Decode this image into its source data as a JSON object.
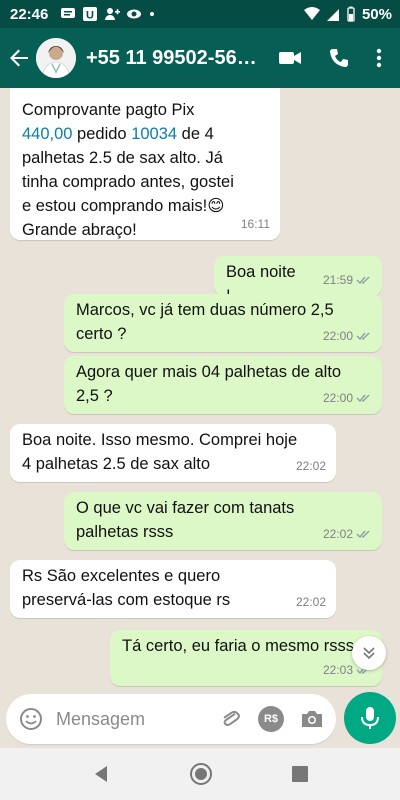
{
  "status": {
    "time": "22:46",
    "battery": "50%"
  },
  "header": {
    "contact": "+55 11 99502-56…"
  },
  "messages": [
    {
      "dir": "in",
      "lines": [
        "Comprovante pagto Pix",
        "440,00 pedido 10034 de 4",
        "palhetas 2.5 de sax alto. Já",
        "tinha comprado antes, gostei",
        "e estou comprando mais!😊",
        "Grande abraço!"
      ],
      "time": "16:11"
    },
    {
      "dir": "out",
      "lines": [
        "Boa noite !"
      ],
      "time": "21:59"
    },
    {
      "dir": "out",
      "lines": [
        "Marcos, vc já tem duas número 2,5",
        "certo ?"
      ],
      "time": "22:00"
    },
    {
      "dir": "out",
      "lines": [
        "Agora quer mais 04 palhetas de alto",
        "2,5 ?"
      ],
      "time": "22:00"
    },
    {
      "dir": "in",
      "lines": [
        "Boa noite. Isso mesmo. Comprei hoje",
        "4 palhetas 2.5 de sax alto"
      ],
      "time": "22:02"
    },
    {
      "dir": "out",
      "lines": [
        "O que vc vai fazer com tanats",
        "palhetas rsss"
      ],
      "time": "22:02"
    },
    {
      "dir": "in",
      "lines": [
        "Rs São excelentes e quero",
        "preservá-las com estoque rs"
      ],
      "time": "22:02"
    },
    {
      "dir": "out",
      "lines": [
        "Tá certo, eu faria o mesmo rsss"
      ],
      "time": "22:03"
    }
  ],
  "composer": {
    "placeholder": "Mensagem",
    "currency_label": "R$"
  },
  "colors": {
    "header": "#075e54",
    "statusbar": "#054d44",
    "outgoing": "#dcf8c6",
    "incoming": "#ffffff",
    "accent": "#00a884"
  },
  "icons": [
    "back-arrow-icon",
    "video-call-icon",
    "phone-icon",
    "more-options-icon",
    "emoji-icon",
    "attach-icon",
    "currency-icon",
    "camera-icon",
    "mic-icon",
    "double-check-icon",
    "scroll-down-icon"
  ]
}
